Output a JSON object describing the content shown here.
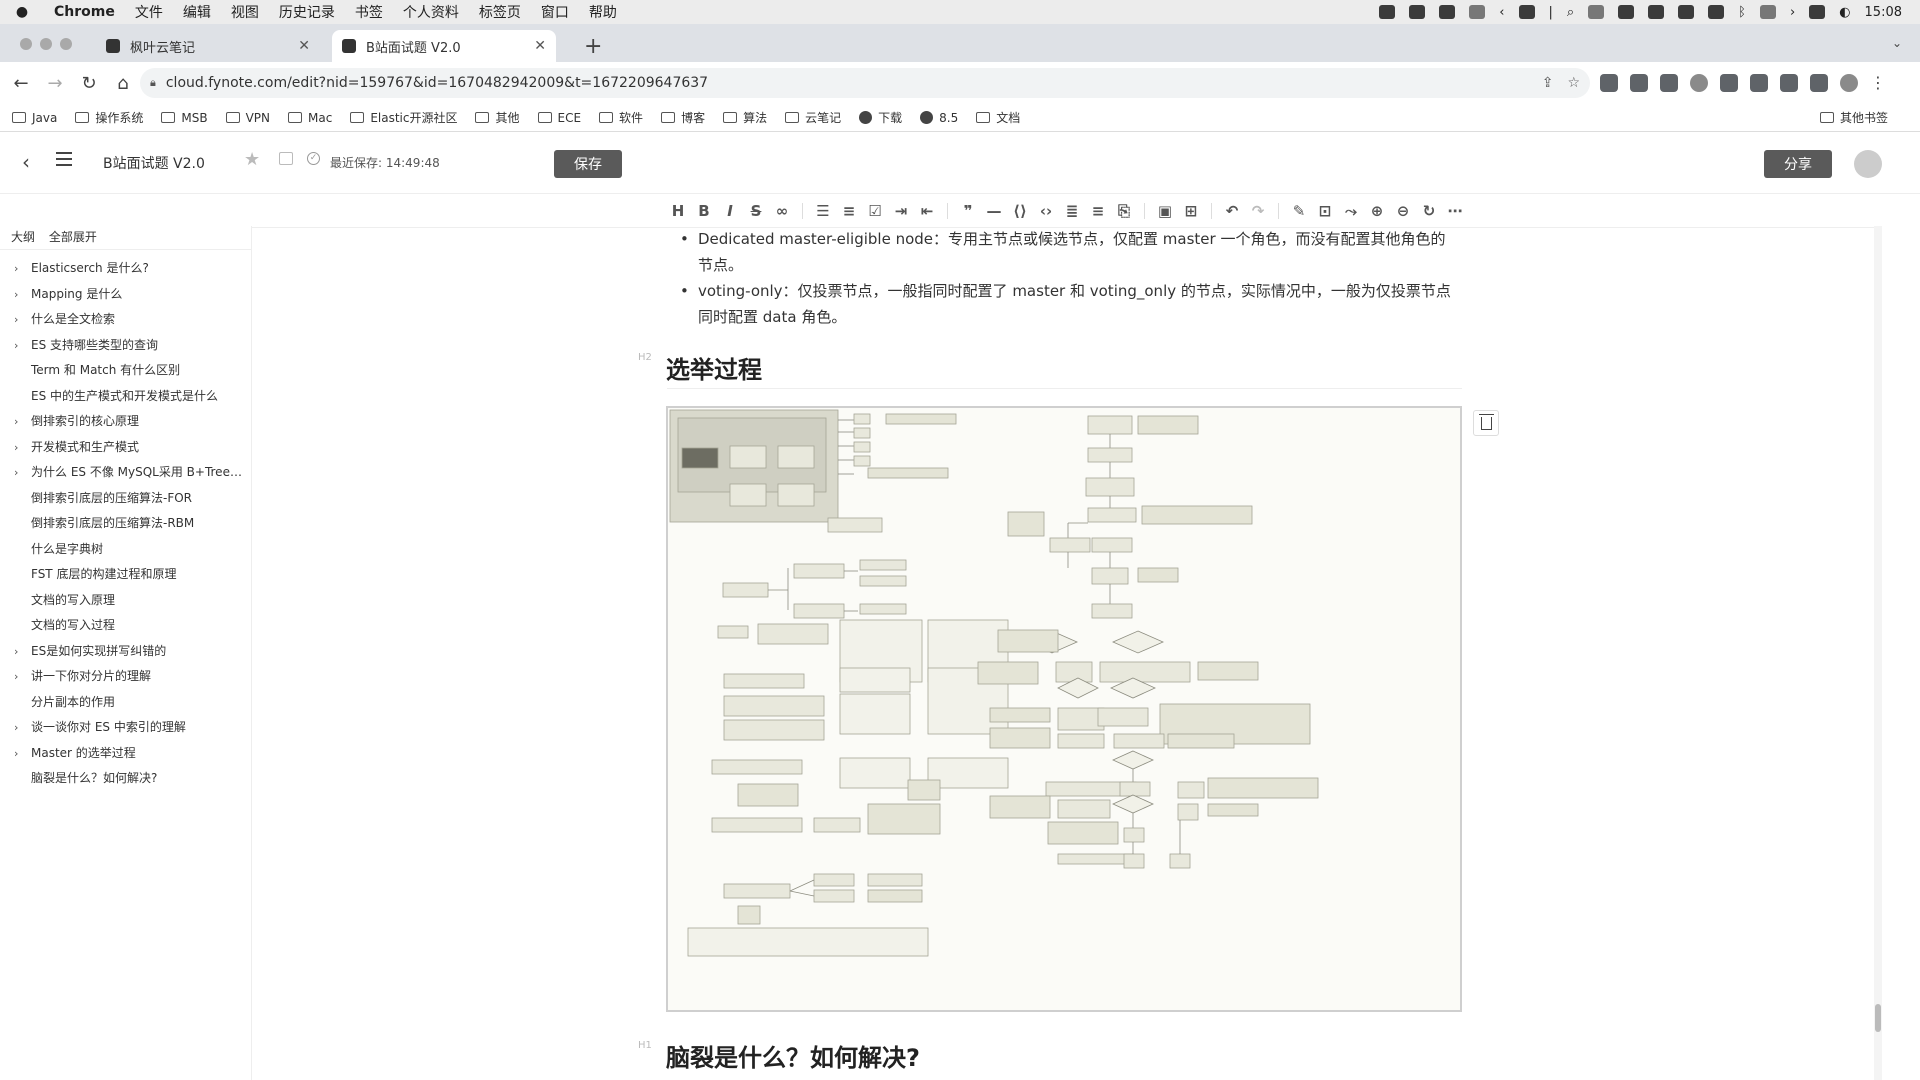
{
  "menubar": {
    "app": "Chrome",
    "items": [
      "文件",
      "编辑",
      "视图",
      "历史记录",
      "书签",
      "个人资料",
      "标签页",
      "窗口",
      "帮助"
    ],
    "clock": "15:08"
  },
  "tabs": [
    {
      "label": "枫叶云笔记"
    },
    {
      "label": "B站面试题 V2.0"
    }
  ],
  "address": {
    "url": "cloud.fynote.com/edit?nid=159767&id=1670482942009&t=1672209647637"
  },
  "bookmarks": {
    "items": [
      "Java",
      "操作系统",
      "MSB",
      "VPN",
      "Mac",
      "Elastic开源社区",
      "其他",
      "ECE",
      "软件",
      "博客",
      "算法",
      "云笔记",
      "下载",
      "8.5",
      "文档"
    ],
    "other": "其他书签"
  },
  "header": {
    "title": "B站面试题 V2.0",
    "saved": "最近保存: 14:49:48",
    "save": "保存",
    "share": "分享"
  },
  "outline": {
    "tab": "大纲",
    "expand": "全部展开",
    "items": [
      {
        "label": "Elasticserch 是什么?",
        "arrow": "›"
      },
      {
        "label": "Mapping 是什么",
        "arrow": "›"
      },
      {
        "label": "什么是全文检索",
        "arrow": "›"
      },
      {
        "label": "ES 支持哪些类型的查询",
        "arrow": "›"
      },
      {
        "label": "Term 和 Match 有什么区别",
        "arrow": ""
      },
      {
        "label": "ES 中的生产模式和开发模式是什么",
        "arrow": ""
      },
      {
        "label": "倒排索引的核心原理",
        "arrow": "›"
      },
      {
        "label": "开发模式和生产模式",
        "arrow": "›"
      },
      {
        "label": "为什么 ES 不像 MySQL采用 B+Trees...",
        "arrow": "›"
      },
      {
        "label": "倒排索引底层的压缩算法-FOR",
        "arrow": ""
      },
      {
        "label": "倒排索引底层的压缩算法-RBM",
        "arrow": ""
      },
      {
        "label": "什么是字典树",
        "arrow": ""
      },
      {
        "label": "FST 底层的构建过程和原理",
        "arrow": ""
      },
      {
        "label": "文档的写入原理",
        "arrow": ""
      },
      {
        "label": "文档的写入过程",
        "arrow": ""
      },
      {
        "label": "ES是如何实现拼写纠错的",
        "arrow": "›"
      },
      {
        "label": "讲一下你对分片的理解",
        "arrow": "›"
      },
      {
        "label": "分片副本的作用",
        "arrow": ""
      },
      {
        "label": "谈一谈你对 ES 中索引的理解",
        "arrow": "›"
      },
      {
        "label": "Master 的选举过程",
        "arrow": "›"
      },
      {
        "label": "脑裂是什么？如何解决?",
        "arrow": ""
      }
    ]
  },
  "content": {
    "bullet1": "Dedicated master-eligible node：专用主节点或候选节点，仅配置 master 一个角色，而没有配置其他角色的节点。",
    "bullet2": "voting-only：仅投票节点，一般指同时配置了 master 和 voting_only 的节点，实际情况中，一般为仅投票节点同时配置 data 角色。",
    "h2_tag": "H2",
    "h2": "选举过程",
    "h1_tag": "H1",
    "h1": "脑裂是什么？如何解决?"
  }
}
